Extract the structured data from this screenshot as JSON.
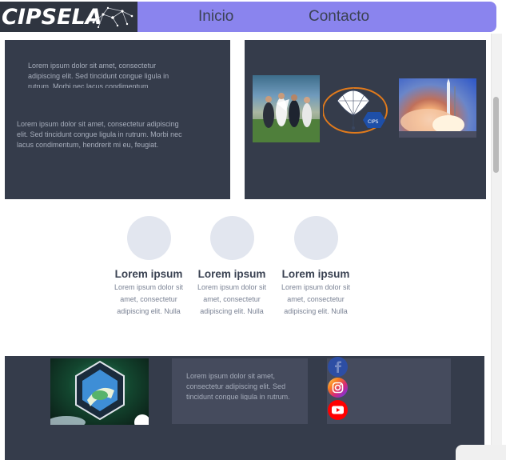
{
  "header": {
    "logo_text": "CIPSELA",
    "nav": [
      {
        "label": "Inicio"
      },
      {
        "label": "Contacto"
      }
    ]
  },
  "top_section": {
    "panel_left": {
      "text1": "Lorem ipsum dolor sit amet, consectetur adipiscing elit. Sed tincidunt congue ligula in rutrum. Morbi nec lacus condimentum",
      "text2": "Lorem ipsum dolor sit amet, consectetur adipiscing elit. Sed tincidunt congue ligula in rutrum. Morbi nec lacus condimentum, hendrerit mi eu, feugiat."
    }
  },
  "features": [
    {
      "title": "Lorem ipsum",
      "text": "Lorem ipsum dolor sit amet, consectetur adipiscing elit. Nulla"
    },
    {
      "title": "Lorem ipsum",
      "text": "Lorem ipsum dolor sit amet, consectetur adipiscing elit. Nulla"
    },
    {
      "title": "Lorem ipsum",
      "text": "Lorem ipsum dolor sit amet, consectetur adipiscing elit. Nulla"
    }
  ],
  "footer": {
    "text": "Lorem ipsum dolor sit amet, consectetur adipiscing elit. Sed tincidunt congue ligula in rutrum.",
    "social": [
      {
        "icon": "facebook-icon"
      },
      {
        "icon": "instagram-icon"
      },
      {
        "icon": "youtube-icon"
      }
    ]
  },
  "colors": {
    "nav_bg": "#8a84ee",
    "logo_bg": "#2f3540",
    "panel_bg": "#353c4b",
    "box_bg": "#454b5d"
  }
}
